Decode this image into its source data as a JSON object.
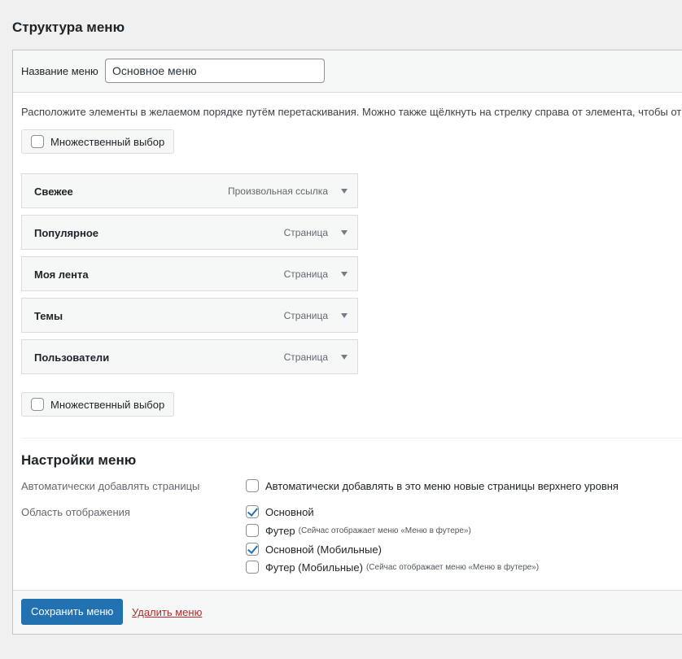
{
  "page_title": "Структура меню",
  "menu_name": {
    "label": "Название меню",
    "value": "Основное меню"
  },
  "instructions": "Расположите элементы в желаемом порядке путём перетаскивания. Можно также щёлкнуть на стрелку справа от элемента, чтобы откр",
  "bulk_select_label": "Множественный выбор",
  "menu_items": [
    {
      "title": "Свежее",
      "type": "Произвольная ссылка"
    },
    {
      "title": "Популярное",
      "type": "Страница"
    },
    {
      "title": "Моя лента",
      "type": "Страница"
    },
    {
      "title": "Темы",
      "type": "Страница"
    },
    {
      "title": "Пользователи",
      "type": "Страница"
    }
  ],
  "settings": {
    "title": "Настройки меню",
    "auto_add_label": "Автоматически добавлять страницы",
    "auto_add_option": {
      "label": "Автоматически добавлять в это меню новые страницы верхнего уровня",
      "checked": false
    },
    "locations_label": "Область отображения",
    "locations": [
      {
        "label": "Основной",
        "note": "",
        "checked": true
      },
      {
        "label": "Футер",
        "note": "(Сейчас отображает меню «Меню в футере»)",
        "checked": false
      },
      {
        "label": "Основной (Мобильные)",
        "note": "",
        "checked": true
      },
      {
        "label": "Футер (Мобильные)",
        "note": "(Сейчас отображает меню «Меню в футере»)",
        "checked": false
      }
    ]
  },
  "footer": {
    "save_label": "Сохранить меню",
    "delete_label": "Удалить меню"
  },
  "colors": {
    "primary": "#2271b1",
    "delete": "#b32d2e"
  }
}
